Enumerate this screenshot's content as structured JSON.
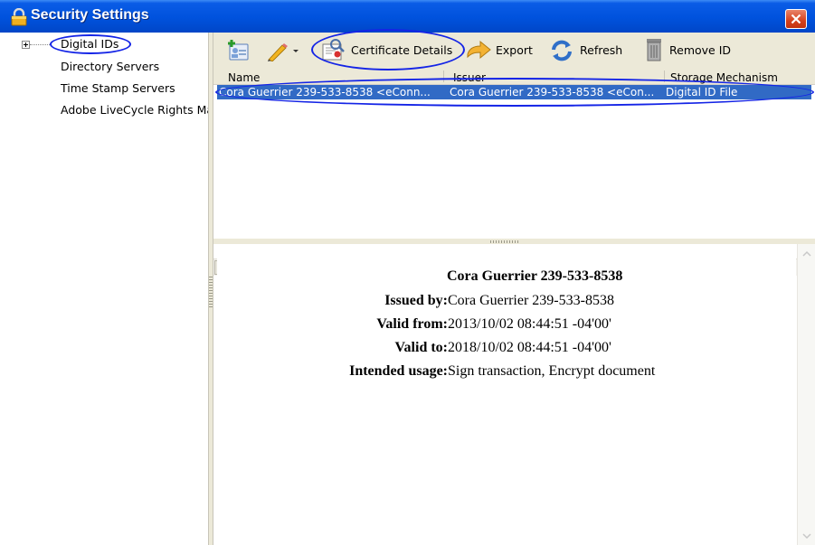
{
  "window": {
    "title": "Security Settings",
    "title_icon": "lock-icon",
    "close_icon": "close-icon"
  },
  "sidebar": {
    "items": [
      {
        "label": "Digital IDs"
      },
      {
        "label": "Directory Servers"
      },
      {
        "label": "Time Stamp Servers"
      },
      {
        "label": "Adobe LiveCycle Rights Ma"
      }
    ]
  },
  "toolbar": {
    "add_icon": "add-id-icon",
    "edit_icon": "pencil-icon",
    "certificate_details": "Certificate Details",
    "export": "Export",
    "refresh": "Refresh",
    "remove_id": "Remove ID"
  },
  "table": {
    "columns": [
      "Name",
      "Issuer",
      "Storage Mechanism"
    ],
    "rows": [
      [
        "Cora Guerrier 239-533-8538 <eConn...",
        "Cora Guerrier 239-533-8538 <eCon...",
        "Digital ID File"
      ]
    ]
  },
  "details": {
    "name": "Cora Guerrier 239-533-8538",
    "issued_by_label": "Issued by:",
    "issued_by": "Cora Guerrier 239-533-8538",
    "valid_from_label": "Valid from:",
    "valid_from": "2013/10/02 08:44:51 -04'00'",
    "valid_to_label": "Valid to:",
    "valid_to": "2018/10/02 08:44:51 -04'00'",
    "usage_label": "Intended usage:",
    "usage": "Sign transaction, Encrypt document"
  },
  "colors": {
    "title_bar": "#0052dd",
    "selection": "#316ac5",
    "annotation": "#1424e6",
    "chrome": "#ece9d8"
  }
}
